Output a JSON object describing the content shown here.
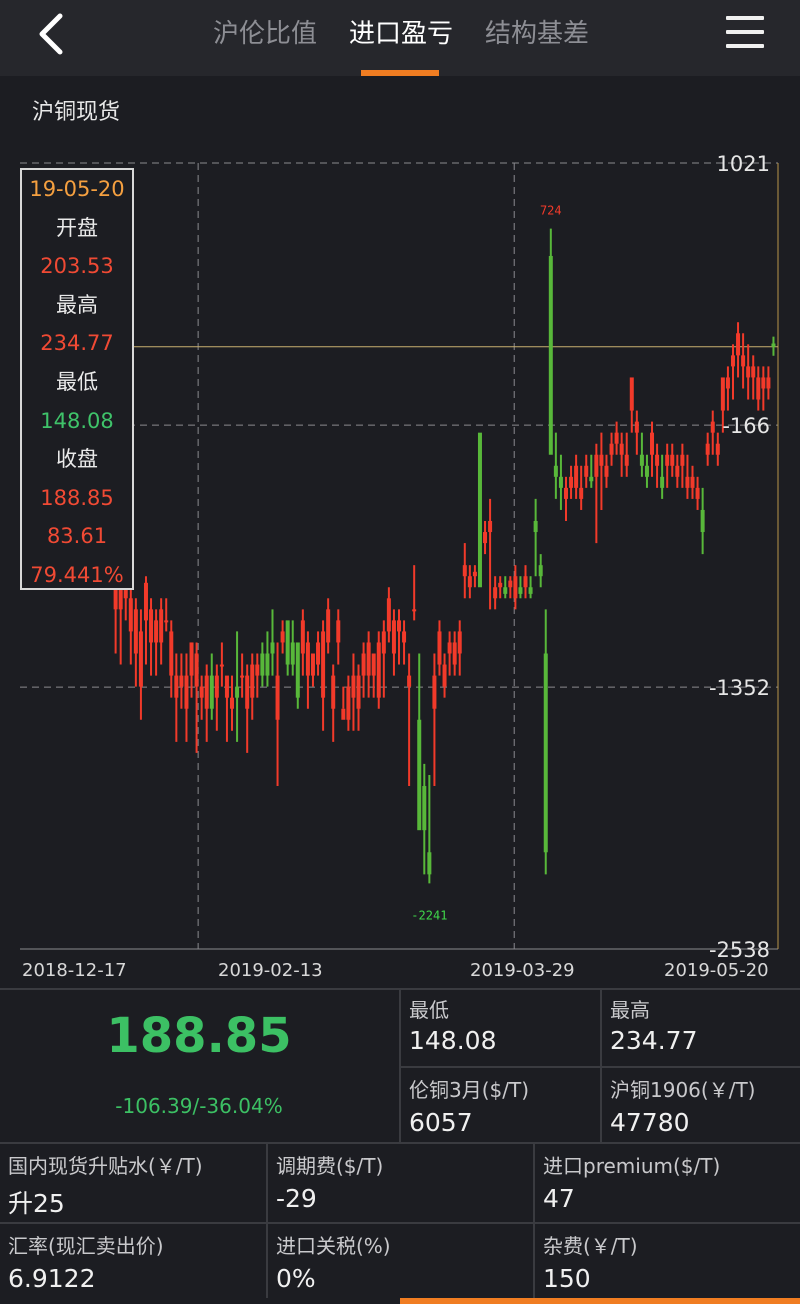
{
  "nav": {
    "tabs": [
      {
        "label": "沪伦比值",
        "active": false
      },
      {
        "label": "进口盈亏",
        "active": true
      },
      {
        "label": "结构基差",
        "active": false
      }
    ],
    "accent_color": "#f07d22"
  },
  "subtitle": "沪铜现货",
  "tooltip": {
    "date": "19-05-20",
    "open_label": "开盘",
    "open": "203.53",
    "high_label": "最高",
    "high": "234.77",
    "low_label": "最低",
    "low": "148.08",
    "close_label": "收盘",
    "close": "188.85",
    "change": "83.61",
    "change_pct": "79.441%"
  },
  "chart_data": {
    "type": "candlestick",
    "x_ticks": [
      "2018-12-17",
      "2019-02-13",
      "2019-03-29",
      "2019-05-20"
    ],
    "y_ticks": [
      "1021",
      "-166",
      "-1352",
      "-2538"
    ],
    "ylim": [
      -2538,
      1021
    ],
    "max_label": "724",
    "min_label": "-2241",
    "crosshair_value": 188.85,
    "up_color": "#f23a2a",
    "down_color": "#58b83a",
    "candles": [
      [
        -400,
        -300,
        -650,
        -420
      ],
      [
        -150,
        -50,
        -350,
        -100
      ],
      [
        -180,
        -60,
        -300,
        -230
      ],
      [
        -200,
        -100,
        -450,
        -250
      ],
      [
        -100,
        100,
        -300,
        50
      ],
      [
        -300,
        -200,
        -500,
        -350
      ],
      [
        -350,
        -250,
        -700,
        -550
      ],
      [
        -400,
        -200,
        -750,
        -620
      ],
      [
        -350,
        -100,
        -700,
        -200
      ],
      [
        -150,
        0,
        -250,
        -100
      ],
      [
        -100,
        50,
        -200,
        -50
      ],
      [
        -50,
        100,
        -150,
        20
      ],
      [
        -100,
        30,
        -200,
        -50
      ],
      [
        -100,
        50,
        -200,
        0
      ],
      [
        -300,
        0,
        -400,
        -150
      ],
      [
        -80,
        0,
        -180,
        -120
      ],
      [
        -130,
        0,
        -150,
        -80
      ],
      [
        -700,
        -450,
        -850,
        -550
      ],
      [
        -1000,
        -550,
        -1200,
        -550
      ],
      [
        -1000,
        -700,
        -1250,
        -880
      ],
      [
        -950,
        -850,
        -1050,
        -900
      ],
      [
        -1100,
        -900,
        -1250,
        -950
      ],
      [
        -1200,
        -950,
        -1350,
        -1000
      ],
      [
        -1350,
        -1000,
        -1500,
        -1100
      ],
      [
        -1050,
        -850,
        -1250,
        -880
      ],
      [
        -1150,
        -950,
        -1300,
        -1000
      ],
      [
        -1150,
        -1000,
        -1300,
        -1050
      ],
      [
        -1150,
        -950,
        -1250,
        -1000
      ],
      [
        -1050,
        -950,
        -1100,
        -1050
      ],
      [
        -1300,
        -1050,
        -1400,
        -1100
      ],
      [
        -1400,
        -1200,
        -1600,
        -1300
      ],
      [
        -1350,
        -1200,
        -1450,
        -1300
      ],
      [
        -1450,
        -1200,
        -1600,
        -1300
      ],
      [
        -1300,
        -1150,
        -1400,
        -1150
      ],
      [
        -1350,
        -1150,
        -1650,
        -1200
      ],
      [
        -1400,
        -1300,
        -1500,
        -1350
      ],
      [
        -1450,
        -1250,
        -1600,
        -1300
      ],
      [
        -1300,
        -1200,
        -1500,
        -1450
      ],
      [
        -1400,
        -1250,
        -1550,
        -1300
      ],
      [
        -1250,
        -1150,
        -1350,
        -1250
      ],
      [
        -1400,
        -1350,
        -1600,
        -1300
      ],
      [
        -1450,
        -1300,
        -1550,
        -1400
      ],
      [
        -1350,
        -1100,
        -1600,
        -1400
      ],
      [
        -1300,
        -1200,
        -1400,
        -1300
      ],
      [
        -1450,
        -1250,
        -1650,
        -1300
      ],
      [
        -1400,
        -1200,
        -1500,
        -1250
      ],
      [
        -1300,
        -1200,
        -1400,
        -1250
      ],
      [
        -1200,
        -1150,
        -1350,
        -1300
      ],
      [
        -1200,
        -1100,
        -1350,
        -1300
      ],
      [
        -1150,
        -1000,
        -1300,
        -1200
      ],
      [
        -1500,
        -1150,
        -1800,
        -1300
      ],
      [
        -1150,
        -1050,
        -1200,
        -1100
      ],
      [
        -1050,
        -1100,
        -1300,
        -1250
      ],
      [
        -1150,
        -1050,
        -1300,
        -1250
      ],
      [
        -1150,
        -1150,
        -1450,
        -1400
      ],
      [
        -1200,
        -1000,
        -1300,
        -1050
      ],
      [
        -1300,
        -1100,
        -1450,
        -1150
      ],
      [
        -1300,
        -1200,
        -1350,
        -1200
      ],
      [
        -1250,
        -1100,
        -1300,
        -1150
      ],
      [
        -1400,
        -1050,
        -1550,
        -1100
      ],
      [
        -1150,
        -950,
        -1200,
        -1000
      ],
      [
        -1450,
        -1250,
        -1600,
        -1300
      ],
      [
        -1150,
        -1000,
        -1250,
        -1050
      ],
      [
        -1500,
        -1350,
        -1450,
        -1450
      ],
      [
        -1500,
        -1300,
        -1550,
        -1350
      ],
      [
        -1400,
        -1200,
        -1550,
        -1300
      ],
      [
        -1450,
        -1250,
        -1550,
        -1300
      ],
      [
        -1300,
        -1150,
        -1400,
        -1200
      ],
      [
        -1300,
        -1100,
        -1400,
        -1150
      ],
      [
        -1300,
        -1200,
        -1400,
        -1200
      ],
      [
        -1400,
        -1100,
        -1450,
        -1150
      ],
      [
        -1200,
        -1050,
        -1400,
        -1100
      ],
      [
        -1100,
        -900,
        -1150,
        -950
      ],
      [
        -1200,
        -1000,
        -1300,
        -1050
      ],
      [
        -1100,
        -1000,
        -1250,
        -1050
      ],
      [
        -1150,
        -1050,
        -1250,
        -1100
      ],
      [
        -1350,
        -1200,
        -1800,
        -1300
      ],
      [
        -1000,
        -800,
        -1050,
        -1000
      ],
      [
        -1500,
        -1200,
        -1800,
        -2000
      ],
      [
        -1800,
        -1700,
        -2200,
        -2000
      ],
      [
        -2100,
        -1750,
        -2241,
        -2200
      ],
      [
        -1450,
        -1200,
        -1800,
        -1300
      ],
      [
        -1250,
        -1050,
        -1300,
        -1100
      ],
      [
        -1350,
        -1200,
        -1400,
        -1250
      ],
      [
        -1200,
        -1100,
        -1300,
        -1150
      ],
      [
        -1250,
        -1100,
        -1300,
        -1150
      ],
      [
        -1200,
        -1050,
        -1300,
        -1100
      ],
      [
        -850,
        -700,
        -950,
        -800
      ],
      [
        -900,
        -800,
        -950,
        -850
      ],
      [
        -850,
        -800,
        -900,
        -830
      ],
      [
        -200,
        -300,
        -700,
        -900
      ],
      [
        -700,
        -600,
        -750,
        -650
      ],
      [
        -650,
        -500,
        -1000,
        -600
      ],
      [
        -950,
        -850,
        -1000,
        -900
      ],
      [
        -900,
        -850,
        -950,
        -880
      ],
      [
        -900,
        -850,
        -950,
        -930
      ],
      [
        -900,
        -850,
        -950,
        -870
      ],
      [
        -950,
        -800,
        -1000,
        -850
      ],
      [
        -900,
        -850,
        -950,
        -930
      ],
      [
        -900,
        -800,
        -950,
        -850
      ],
      [
        -900,
        -850,
        -950,
        -930
      ],
      [
        -600,
        -500,
        -850,
        -650
      ],
      [
        -800,
        -750,
        -900,
        -850
      ],
      [
        -1200,
        -1000,
        -2200,
        -2100
      ],
      [
        600,
        724,
        -200,
        -300
      ],
      [
        -350,
        -200,
        -500,
        -400
      ],
      [
        -400,
        -300,
        -550,
        -450
      ],
      [
        -500,
        -400,
        -600,
        -450
      ],
      [
        -450,
        -350,
        -500,
        -400
      ],
      [
        -450,
        -300,
        -500,
        -350
      ],
      [
        -500,
        -350,
        -550,
        -450
      ],
      [
        -400,
        -300,
        -450,
        -350
      ],
      [
        -400,
        -300,
        -450,
        -420
      ],
      [
        -400,
        -250,
        -700,
        -300
      ],
      [
        -350,
        -200,
        -550,
        -300
      ],
      [
        -400,
        -300,
        -450,
        -350
      ],
      [
        -300,
        -200,
        -350,
        -250
      ],
      [
        -250,
        -150,
        -300,
        -200
      ],
      [
        -300,
        -200,
        -400,
        -250
      ],
      [
        -350,
        -200,
        -400,
        -300
      ],
      [
        -100,
        0,
        -200,
        50
      ],
      [
        -200,
        -100,
        -300,
        -150
      ],
      [
        -300,
        -200,
        -400,
        -350
      ],
      [
        -350,
        -300,
        -450,
        -400
      ],
      [
        -300,
        -150,
        -400,
        -200
      ],
      [
        -350,
        -250,
        -450,
        -300
      ],
      [
        -400,
        -300,
        -500,
        -450
      ],
      [
        -350,
        -250,
        -450,
        -300
      ],
      [
        -350,
        -250,
        -400,
        -300
      ],
      [
        -400,
        -300,
        -450,
        -350
      ],
      [
        -350,
        -250,
        -450,
        -300
      ],
      [
        -450,
        -300,
        -500,
        -400
      ],
      [
        -450,
        -350,
        -500,
        -400
      ],
      [
        -500,
        -400,
        -550,
        -450
      ],
      [
        -550,
        -450,
        -750,
        -650
      ],
      [
        -300,
        -200,
        -350,
        -250
      ],
      [
        -200,
        -100,
        -300,
        -150
      ],
      [
        -300,
        -200,
        -350,
        -250
      ],
      [
        -100,
        0,
        -200,
        50
      ],
      [
        0,
        100,
        -100,
        50
      ],
      [
        100,
        200,
        -50,
        150
      ],
      [
        150,
        300,
        50,
        250
      ],
      [
        100,
        250,
        0,
        150
      ],
      [
        50,
        200,
        -50,
        100
      ],
      [
        50,
        150,
        -50,
        100
      ],
      [
        -50,
        100,
        -100,
        50
      ],
      [
        0,
        100,
        -100,
        50
      ],
      [
        0,
        100,
        -50,
        50
      ],
      [
        203.53,
        234.77,
        148.08,
        188.85
      ]
    ]
  },
  "stats": {
    "price": "188.85",
    "change": "-106.39/-36.04%",
    "low_label": "最低",
    "low_value": "148.08",
    "high_label": "最高",
    "high_value": "234.77",
    "lme_label": "伦铜3月($/T)",
    "lme_value": "6057",
    "shfe_label": "沪铜1906(￥/T)",
    "shfe_value": "47780"
  },
  "details": {
    "premium_label": "国内现货升贴水(￥/T)",
    "premium_value": "升25",
    "tom_label": "调期费($/T)",
    "tom_value": "-29",
    "import_label": "进口premium($/T)",
    "import_value": "47",
    "fx_label": "汇率(现汇卖出价)",
    "fx_value": "6.9122",
    "tariff_label": "进口关税(%)",
    "tariff_value": "0%",
    "misc_label": "杂费(￥/T)",
    "misc_value": "150"
  }
}
